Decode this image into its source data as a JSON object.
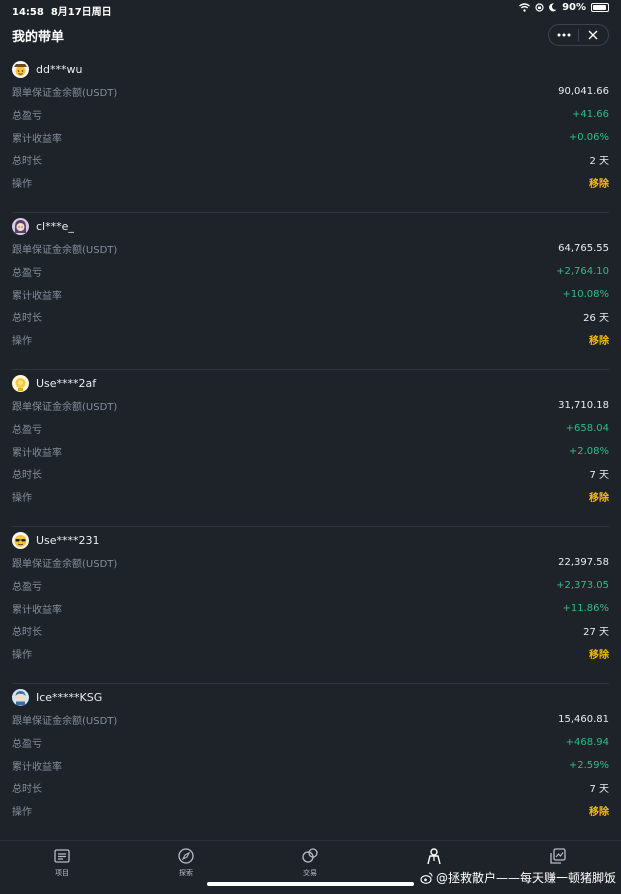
{
  "status_bar": {
    "time": "14:58",
    "date": "8月17日周日",
    "battery": "90%",
    "battery_level": 0.9
  },
  "header": {
    "title": "我的带单",
    "more_icon": "more-dots-icon",
    "close_icon": "close-icon"
  },
  "labels": {
    "margin_balance": "跟单保证金余额(USDT)",
    "total_pnl": "总盈亏",
    "cumulative_return": "累计收益率",
    "total_duration": "总时长",
    "action": "操作",
    "remove": "移除"
  },
  "traders": [
    {
      "name": "dd***wu",
      "margin_balance": "90,041.66",
      "total_pnl": "+41.66",
      "cumulative_return": "+0.06%",
      "total_duration": "2 天",
      "avatar_icon": "cowboy-emoji-avatar"
    },
    {
      "name": "cl***e_",
      "margin_balance": "64,765.55",
      "total_pnl": "+2,764.10",
      "cumulative_return": "+10.08%",
      "total_duration": "26 天",
      "avatar_icon": "girl-avatar"
    },
    {
      "name": "Use****2af",
      "margin_balance": "31,710.18",
      "total_pnl": "+658.04",
      "cumulative_return": "+2.08%",
      "total_duration": "7 天",
      "avatar_icon": "yellow-avatar"
    },
    {
      "name": "Use****231",
      "margin_balance": "22,397.58",
      "total_pnl": "+2,373.05",
      "cumulative_return": "+11.86%",
      "total_duration": "27 天",
      "avatar_icon": "sunglasses-emoji-avatar"
    },
    {
      "name": "Ice*****KSG",
      "margin_balance": "15,460.81",
      "total_pnl": "+468.94",
      "cumulative_return": "+2.59%",
      "total_duration": "7 天",
      "avatar_icon": "character-avatar"
    }
  ],
  "tabbar": {
    "tabs": [
      {
        "label": "项目",
        "icon": "list-icon"
      },
      {
        "label": "探索",
        "icon": "compass-icon"
      },
      {
        "label": "交易",
        "icon": "trade-icon"
      },
      {
        "label": "",
        "icon": "person-icon"
      },
      {
        "label": "",
        "icon": "copy-chart-icon"
      }
    ]
  },
  "watermark": {
    "text": "@拯救散户——每天赚一顿猪脚饭"
  },
  "colors": {
    "background": "#1e2329",
    "positive": "#2ebd85",
    "accent": "#f0b90b",
    "label": "#848e9c"
  }
}
